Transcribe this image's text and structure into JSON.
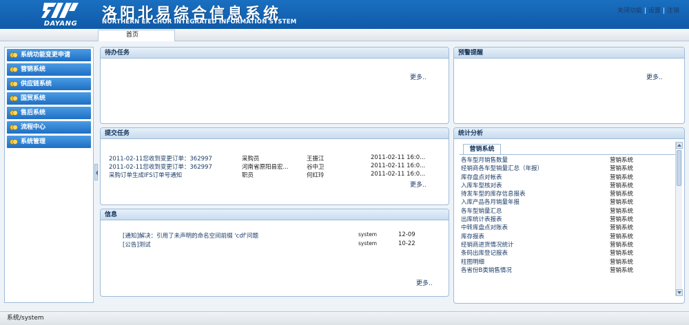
{
  "header": {
    "logo_text": "DAYANG",
    "title": "洛阳北易综合信息系统",
    "subtitle": "NORTHERN EK CHOR INTEGRATED INFORMATION SYSTEM",
    "links": [
      "关闭功能",
      "设置",
      "注销"
    ]
  },
  "tabs": {
    "home": "首页"
  },
  "sidebar": {
    "items": [
      {
        "label": "系统功能变更申请"
      },
      {
        "label": "营销系统"
      },
      {
        "label": "供应链系统"
      },
      {
        "label": "国贸系统"
      },
      {
        "label": "售后系统"
      },
      {
        "label": "流程中心"
      },
      {
        "label": "系统管理"
      }
    ]
  },
  "todo": {
    "title": "待办任务",
    "more": "更多.."
  },
  "alerts": {
    "title": "预警提醒",
    "more": "更多.."
  },
  "submitted": {
    "title": "提交任务",
    "more": "更多..",
    "rows": [
      {
        "text": "2011-02-11您收到变更订单：362997",
        "role": "采购员",
        "person": "王振江",
        "time": "2011-02-11 16:0..."
      },
      {
        "text": "2011-02-11您收到变更订单：362997",
        "role": "河南省原阳县宏...",
        "person": "谷中卫",
        "time": "2011-02-11 16:0..."
      },
      {
        "text": "采购订单生成IFS订单号通知",
        "role": "职员",
        "person": "何红玲",
        "time": "2011-02-11 16:0..."
      }
    ]
  },
  "info": {
    "title": "信息",
    "more": "更多..",
    "rows": [
      {
        "text": "[通知]解决：引用了未声明的命名空间前缀 'cdf'问题",
        "user": "system",
        "date": "12-09"
      },
      {
        "text": "[公告]测试",
        "user": "system",
        "date": "10-22"
      }
    ]
  },
  "stats": {
    "title": "统计分析",
    "tab": "营销系统",
    "rows": [
      {
        "name": "各车型月销售数量",
        "system": "营销系统"
      },
      {
        "name": "经销商各车型销量汇总（年报）",
        "system": "营销系统"
      },
      {
        "name": "库存盘点对帐表",
        "system": "营销系统"
      },
      {
        "name": "入库车型核对表",
        "system": "营销系统"
      },
      {
        "name": "待发车型的库存信息报表",
        "system": "营销系统"
      },
      {
        "name": "入库产品各月销量年报",
        "system": "营销系统"
      },
      {
        "name": "各车型销量汇总",
        "system": "营销系统"
      },
      {
        "name": "出库统计表报表",
        "system": "营销系统"
      },
      {
        "name": "中转库盘点对账表",
        "system": "营销系统"
      },
      {
        "name": "库存报表",
        "system": "营销系统"
      },
      {
        "name": "经销商进货情况统计",
        "system": "营销系统"
      },
      {
        "name": "条码出库登记报表",
        "system": "营销系统"
      },
      {
        "name": "柱图明细",
        "system": "营销系统"
      },
      {
        "name": "各省份B类销售情况",
        "system": "营销系统"
      }
    ]
  },
  "status": {
    "text": "系统/system"
  },
  "colors": {
    "header": "#1a6fc0",
    "sidebar_item": "#2b7fd4",
    "panel_border": "#9dbbd8"
  }
}
